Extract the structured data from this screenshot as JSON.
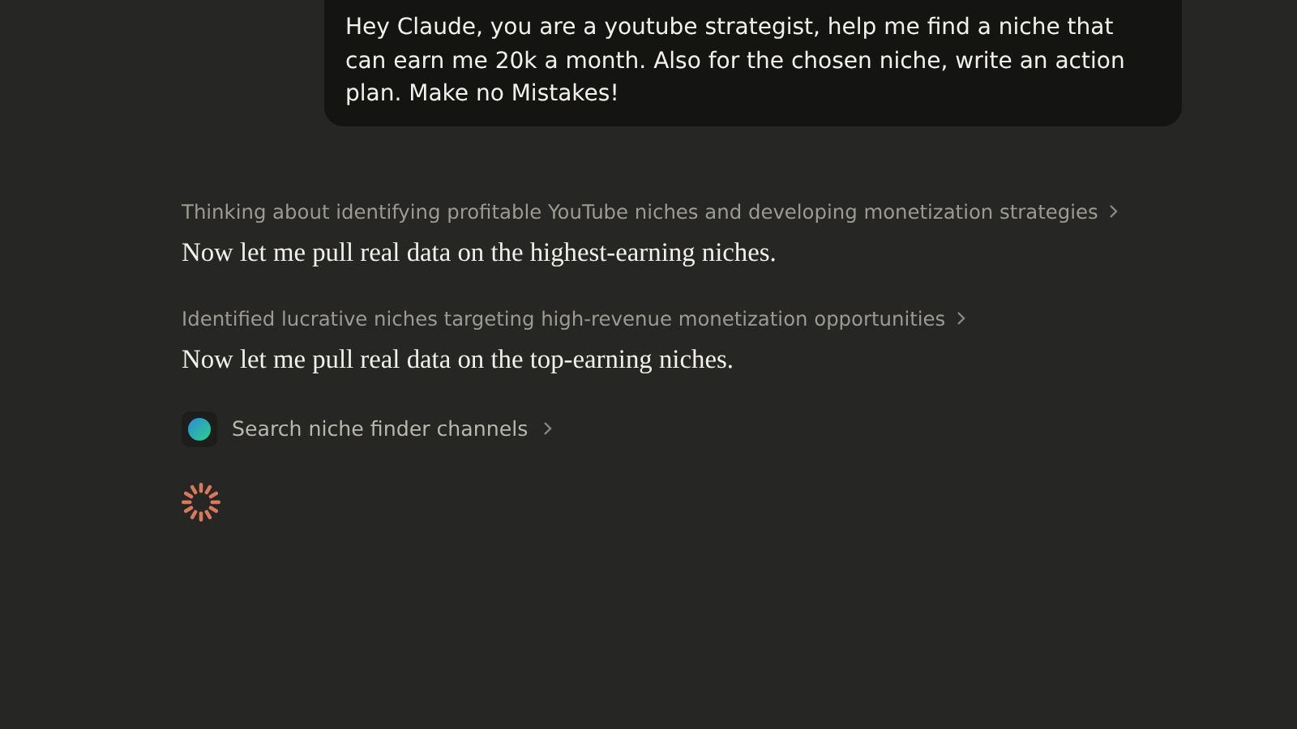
{
  "user_message": {
    "text": "Hey Claude, you are a youtube strategist, help me find a niche that can earn me 20k a month. Also for the chosen niche, write an action plan. Make no Mistakes!"
  },
  "response": [
    {
      "kind": "thinking",
      "text": "Thinking about identifying profitable YouTube niches and developing monetization strategies"
    },
    {
      "kind": "text",
      "text": "Now let me pull real data on the highest-earning niches."
    },
    {
      "kind": "thinking",
      "text": "Identified lucrative niches targeting high-revenue monetization opportunities"
    },
    {
      "kind": "text",
      "text": "Now let me pull real data on the top-earning niches."
    },
    {
      "kind": "tool",
      "text": "Search niche finder channels"
    }
  ]
}
